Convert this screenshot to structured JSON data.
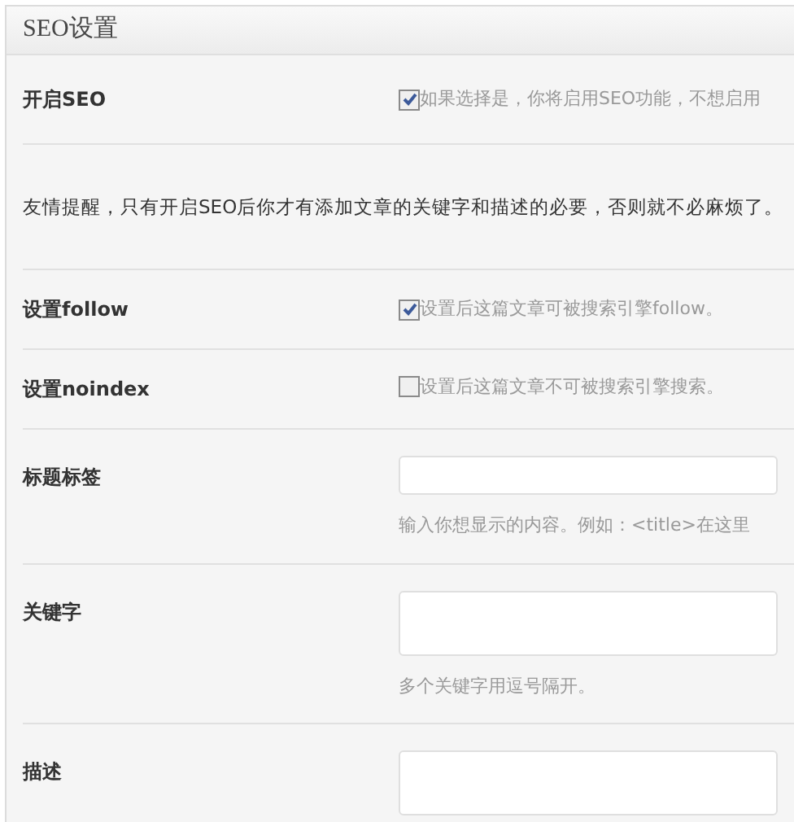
{
  "panel": {
    "title": "SEO设置"
  },
  "rows": [
    {
      "kind": "checkbox",
      "label": "开启SEO",
      "checked": true,
      "text": "如果选择是，你将启用SEO功能，不想启用"
    },
    {
      "kind": "notice",
      "text": "友情提醒，只有开启SEO后你才有添加文章的关键字和描述的必要，否则就不必麻烦了。"
    },
    {
      "kind": "checkbox",
      "label": "设置follow",
      "checked": true,
      "text": "设置后这篇文章可被搜索引擎follow。"
    },
    {
      "kind": "checkbox",
      "label": "设置noindex",
      "checked": false,
      "text": "设置后这篇文章不可被搜索引擎搜索。"
    },
    {
      "kind": "input",
      "label": "标题标签",
      "hint": "输入你想显示的内容。例如：<title>在这里"
    },
    {
      "kind": "textarea",
      "label": "关键字",
      "hint": "多个关键字用逗号隔开。"
    },
    {
      "kind": "textarea",
      "label": "描述"
    }
  ]
}
